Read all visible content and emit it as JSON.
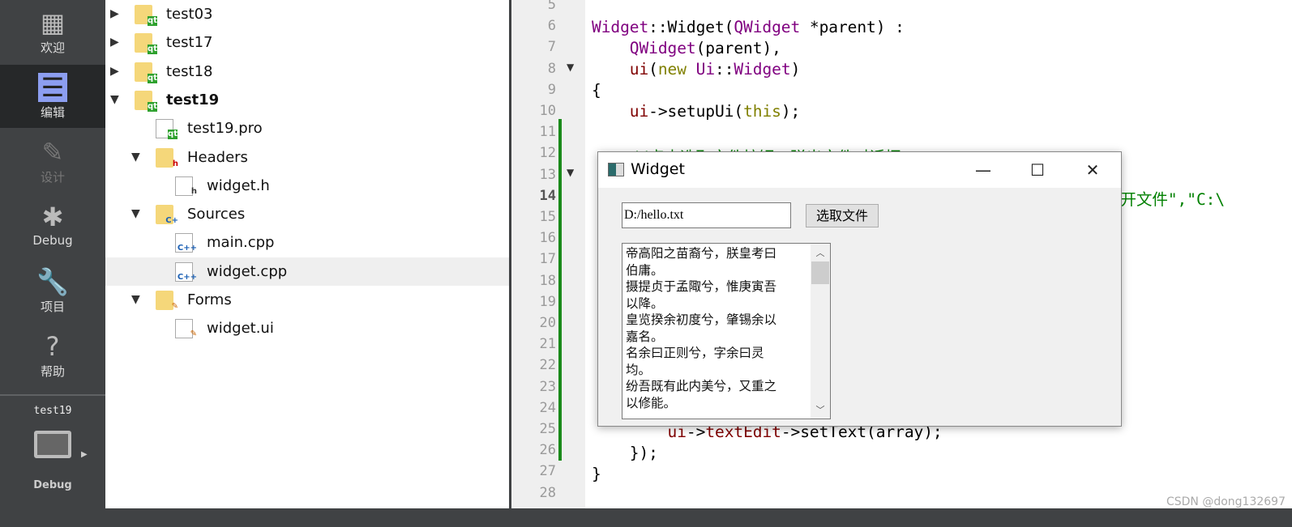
{
  "sidebar": {
    "modes": [
      {
        "label": "欢迎",
        "icon": "grid-icon"
      },
      {
        "label": "编辑",
        "icon": "edit-icon",
        "selected": true
      },
      {
        "label": "设计",
        "icon": "pencil-icon",
        "disabled": true
      },
      {
        "label": "Debug",
        "icon": "bug-icon"
      },
      {
        "label": "项目",
        "icon": "wrench-icon"
      },
      {
        "label": "帮助",
        "icon": "help-icon"
      }
    ],
    "project": "test19",
    "run_config": "Debug"
  },
  "tree": [
    {
      "label": "test03",
      "expanded": false
    },
    {
      "label": "test17",
      "expanded": false
    },
    {
      "label": "test18",
      "expanded": false
    },
    {
      "label": "test19",
      "expanded": true,
      "bold": true
    },
    {
      "label": "test19.pro"
    },
    {
      "label": "Headers",
      "expanded": true
    },
    {
      "label": "widget.h"
    },
    {
      "label": "Sources",
      "expanded": true
    },
    {
      "label": "main.cpp"
    },
    {
      "label": "widget.cpp",
      "selected": true
    },
    {
      "label": "Forms",
      "expanded": true
    },
    {
      "label": "widget.ui"
    }
  ],
  "editor": {
    "line_numbers": [
      "5",
      "6",
      "7",
      "8",
      "9",
      "10",
      "11",
      "12",
      "13",
      "14",
      "15",
      "16",
      "17",
      "18",
      "19",
      "20",
      "21",
      "22",
      "23",
      "24",
      "25",
      "26",
      "27",
      "28"
    ],
    "current_line": "14"
  },
  "dialog": {
    "title": "Widget",
    "path_value": "D:/hello.txt",
    "pick_button": "选取文件",
    "text_lines": [
      "帝高阳之苗裔兮，朕皇考曰",
      "伯庸。",
      "摄提贞于孟陬兮，惟庚寅吾",
      "以降。",
      "皇览揆余初度兮，肇锡余以",
      "嘉名。",
      "名余曰正则兮，字余曰灵",
      "均。",
      "纷吾既有此内美兮，又重之",
      "以修能。"
    ]
  },
  "watermark": "CSDN @dong132697"
}
